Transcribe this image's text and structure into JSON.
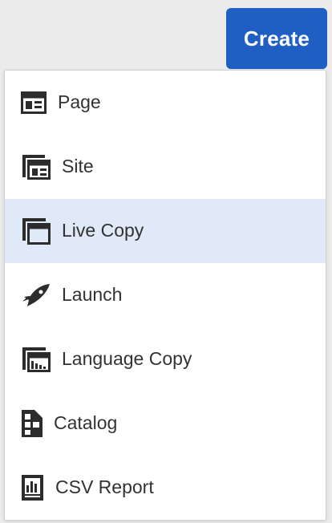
{
  "header": {
    "create_label": "Create"
  },
  "menu": {
    "items": [
      {
        "label": "Page",
        "icon": "page-icon",
        "selected": false
      },
      {
        "label": "Site",
        "icon": "site-icon",
        "selected": false
      },
      {
        "label": "Live Copy",
        "icon": "live-copy-icon",
        "selected": true
      },
      {
        "label": "Launch",
        "icon": "launch-icon",
        "selected": false
      },
      {
        "label": "Language Copy",
        "icon": "language-copy-icon",
        "selected": false
      },
      {
        "label": "Catalog",
        "icon": "catalog-icon",
        "selected": false
      },
      {
        "label": "CSV Report",
        "icon": "csv-report-icon",
        "selected": false
      }
    ]
  },
  "colors": {
    "accent": "#1f5fc4",
    "selected_background": "#dfe9f8",
    "icon": "#2c2c2c",
    "text": "#323232",
    "page_background": "#ebebeb"
  }
}
